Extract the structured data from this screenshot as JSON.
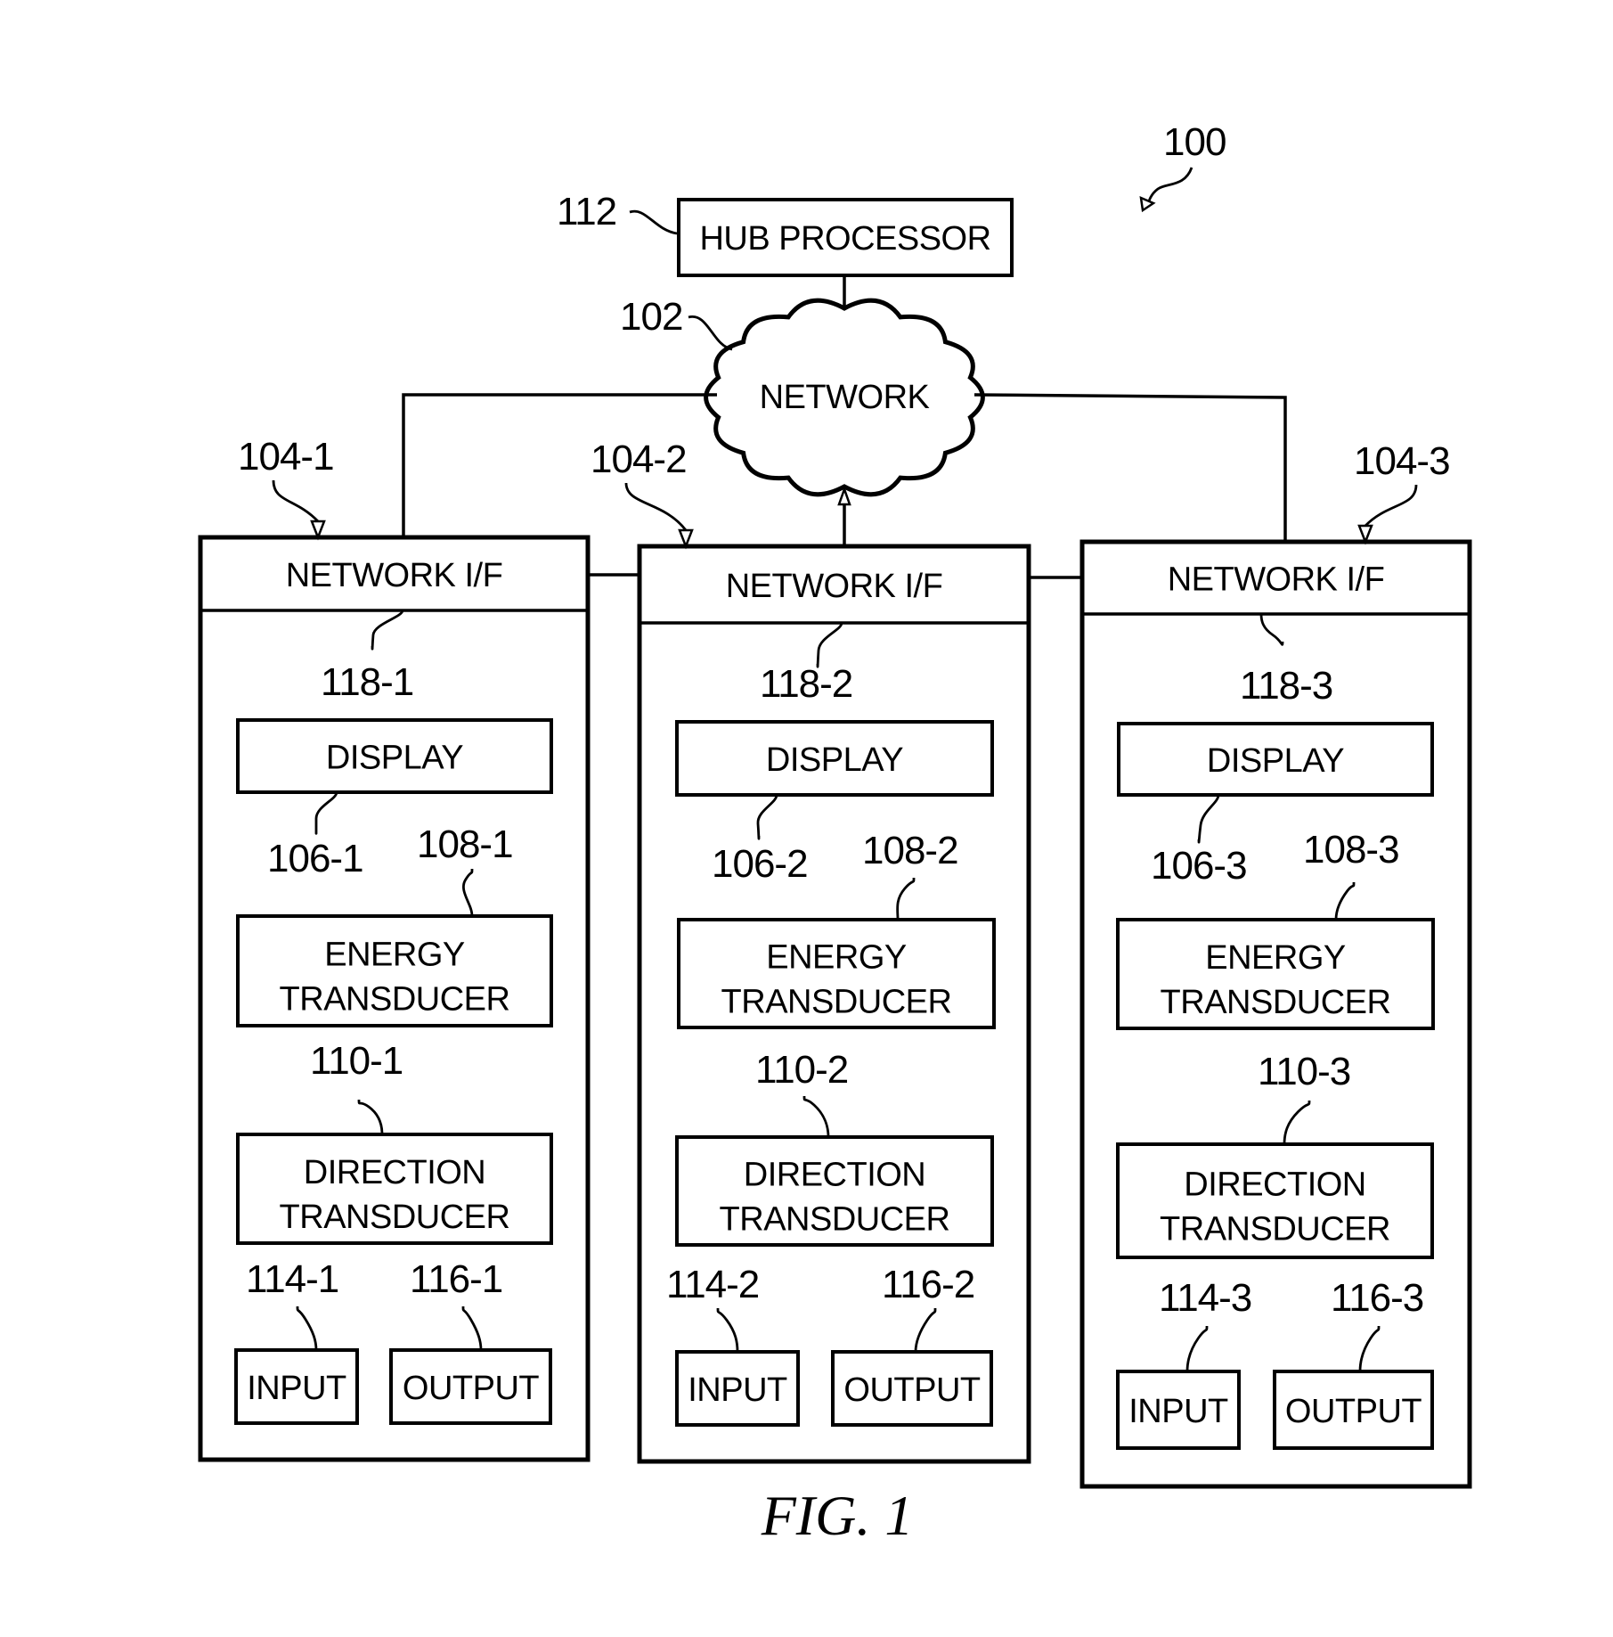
{
  "figure": {
    "caption": "FIG. 1",
    "system_ref": "100",
    "hub": {
      "label": "HUB PROCESSOR",
      "ref": "112"
    },
    "network": {
      "label": "NETWORK",
      "ref": "102"
    },
    "devices": [
      {
        "ref": "104-1",
        "network_if": {
          "label": "NETWORK I/F",
          "ref": "118-1"
        },
        "display": {
          "label": "DISPLAY",
          "ref": "106-1"
        },
        "energy_transducer": {
          "label_line1": "ENERGY",
          "label_line2": "TRANSDUCER",
          "ref": "108-1"
        },
        "direction_transducer": {
          "label_line1": "DIRECTION",
          "label_line2": "TRANSDUCER",
          "ref": "110-1"
        },
        "input": {
          "label": "INPUT",
          "ref": "114-1"
        },
        "output": {
          "label": "OUTPUT",
          "ref": "116-1"
        }
      },
      {
        "ref": "104-2",
        "network_if": {
          "label": "NETWORK I/F",
          "ref": "118-2"
        },
        "display": {
          "label": "DISPLAY",
          "ref": "106-2"
        },
        "energy_transducer": {
          "label_line1": "ENERGY",
          "label_line2": "TRANSDUCER",
          "ref": "108-2"
        },
        "direction_transducer": {
          "label_line1": "DIRECTION",
          "label_line2": "TRANSDUCER",
          "ref": "110-2"
        },
        "input": {
          "label": "INPUT",
          "ref": "114-2"
        },
        "output": {
          "label": "OUTPUT",
          "ref": "116-2"
        }
      },
      {
        "ref": "104-3",
        "network_if": {
          "label": "NETWORK I/F",
          "ref": "118-3"
        },
        "display": {
          "label": "DISPLAY",
          "ref": "106-3"
        },
        "energy_transducer": {
          "label_line1": "ENERGY",
          "label_line2": "TRANSDUCER",
          "ref": "108-3"
        },
        "direction_transducer": {
          "label_line1": "DIRECTION",
          "label_line2": "TRANSDUCER",
          "ref": "110-3"
        },
        "input": {
          "label": "INPUT",
          "ref": "114-3"
        },
        "output": {
          "label": "OUTPUT",
          "ref": "116-3"
        }
      }
    ]
  }
}
